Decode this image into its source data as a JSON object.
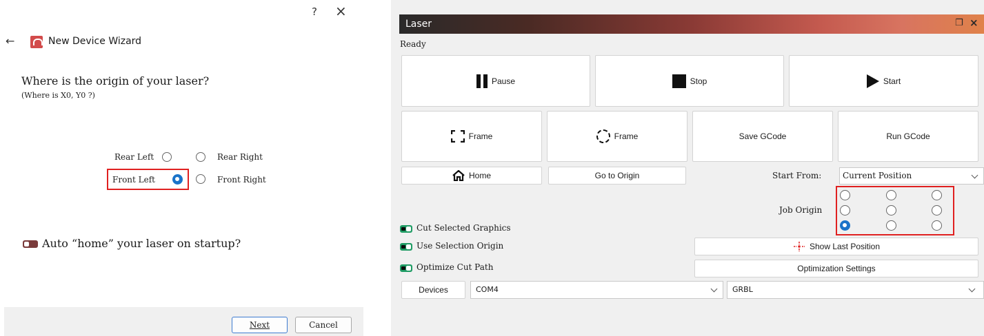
{
  "wizard": {
    "help_label": "?",
    "close_label": "×",
    "back_label": "←",
    "title": "New Device Wizard",
    "question": "Where is the origin of your laser?",
    "subquestion": "(Where is X0, Y0 ?)",
    "origin_options": {
      "rear_left": "Rear Left",
      "rear_right": "Rear Right",
      "front_left": "Front Left",
      "front_right": "Front Right",
      "selected": "Front Left"
    },
    "auto_home_label": "Auto “home” your laser on startup?",
    "auto_home_enabled": false,
    "next_label": "Next",
    "cancel_label": "Cancel"
  },
  "laser": {
    "title": "Laser",
    "float_icon": "restore-icon",
    "close_label": "×",
    "status": "Ready",
    "buttons": {
      "pause": "Pause",
      "stop": "Stop",
      "start": "Start",
      "frame_rect": "Frame",
      "frame_circle": "Frame",
      "save_gcode": "Save GCode",
      "run_gcode": "Run GCode",
      "home": "Home",
      "go_to_origin": "Go to Origin",
      "show_last_position": "Show Last Position",
      "optimization_settings": "Optimization Settings",
      "devices": "Devices"
    },
    "start_from": {
      "label": "Start From:",
      "value": "Current Position"
    },
    "job_origin": {
      "label": "Job Origin",
      "selected_row": 2,
      "selected_col": 0
    },
    "options": [
      {
        "label": "Cut Selected Graphics",
        "enabled": true
      },
      {
        "label": "Use Selection Origin",
        "enabled": true
      },
      {
        "label": "Optimize Cut Path",
        "enabled": true
      }
    ],
    "port": "COM4",
    "device_type": "GRBL",
    "colors": {
      "toggle_on": "#1f9b64",
      "radio_selected": "#1a73c9",
      "highlight": "#e02020",
      "crosshair": "#e02020"
    }
  }
}
